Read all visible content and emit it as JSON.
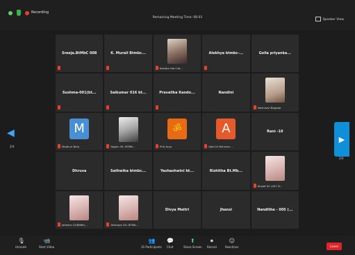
{
  "topbar": {
    "recording_label": "Recording",
    "meeting_time": "Remaining Meeting Time: 06:01",
    "view_label": "Speaker View"
  },
  "tiles": [
    {
      "name": "Sreeja.BtMbC 008",
      "label": ""
    },
    {
      "name": "K. Murali Btmbc...",
      "label": ""
    },
    {
      "name": "",
      "label": "Kahaka Hari Ha...",
      "avatar": "couple"
    },
    {
      "name": "Alekhya btmbc-...",
      "label": ""
    },
    {
      "name": "Golla priyanka...",
      "label": ""
    },
    {
      "name": "Sushma-001(bt...",
      "label": ""
    },
    {
      "name": "Saikumar 016 bt...",
      "label": ""
    },
    {
      "name": "Pravalika Kando...",
      "label": ""
    },
    {
      "name": "Nandini",
      "label": ""
    },
    {
      "name": "",
      "label": "Vaishnavi Bagade",
      "avatar": "photo"
    },
    {
      "name": "",
      "label": "Madhuri Balu",
      "avatar": "M"
    },
    {
      "name": "",
      "label": "Raghu 09- BTMB...",
      "avatar": "dark"
    },
    {
      "name": "",
      "label": "Priti Arya",
      "avatar": "om"
    },
    {
      "name": "",
      "label": "Abid Ur Rahman ...",
      "avatar": "A"
    },
    {
      "name": "Rani -10",
      "label": ""
    },
    {
      "name": "Dhruva",
      "label": ""
    },
    {
      "name": "Sathwika btmbc...",
      "label": ""
    },
    {
      "name": "Yashashwini bt...",
      "label": ""
    },
    {
      "name": "Rishitha Bt.Mb...",
      "label": ""
    },
    {
      "name": "",
      "label": "Khyati Sri (407 D...",
      "avatar": "pink"
    },
    {
      "name": "",
      "label": "Jaheera 22(BtMb)...",
      "avatar": "pink"
    },
    {
      "name": "",
      "label": "Akshaya 02L BTMb...",
      "avatar": "pink"
    },
    {
      "name": "Divya Maitri",
      "label": ""
    },
    {
      "name": "Jhansi",
      "label": ""
    },
    {
      "name": "Nanditha - 005 (...",
      "label": ""
    }
  ],
  "navigation": {
    "left_page": "2/4",
    "right_page": "2/4"
  },
  "toolbar": {
    "unmute": "Unmute",
    "start_video": "Start Video",
    "participants": "Participants",
    "participants_count": "35",
    "chat": "Chat",
    "share_screen": "Share Screen",
    "record": "Record",
    "reactions": "Reactions",
    "end": "Leave"
  }
}
